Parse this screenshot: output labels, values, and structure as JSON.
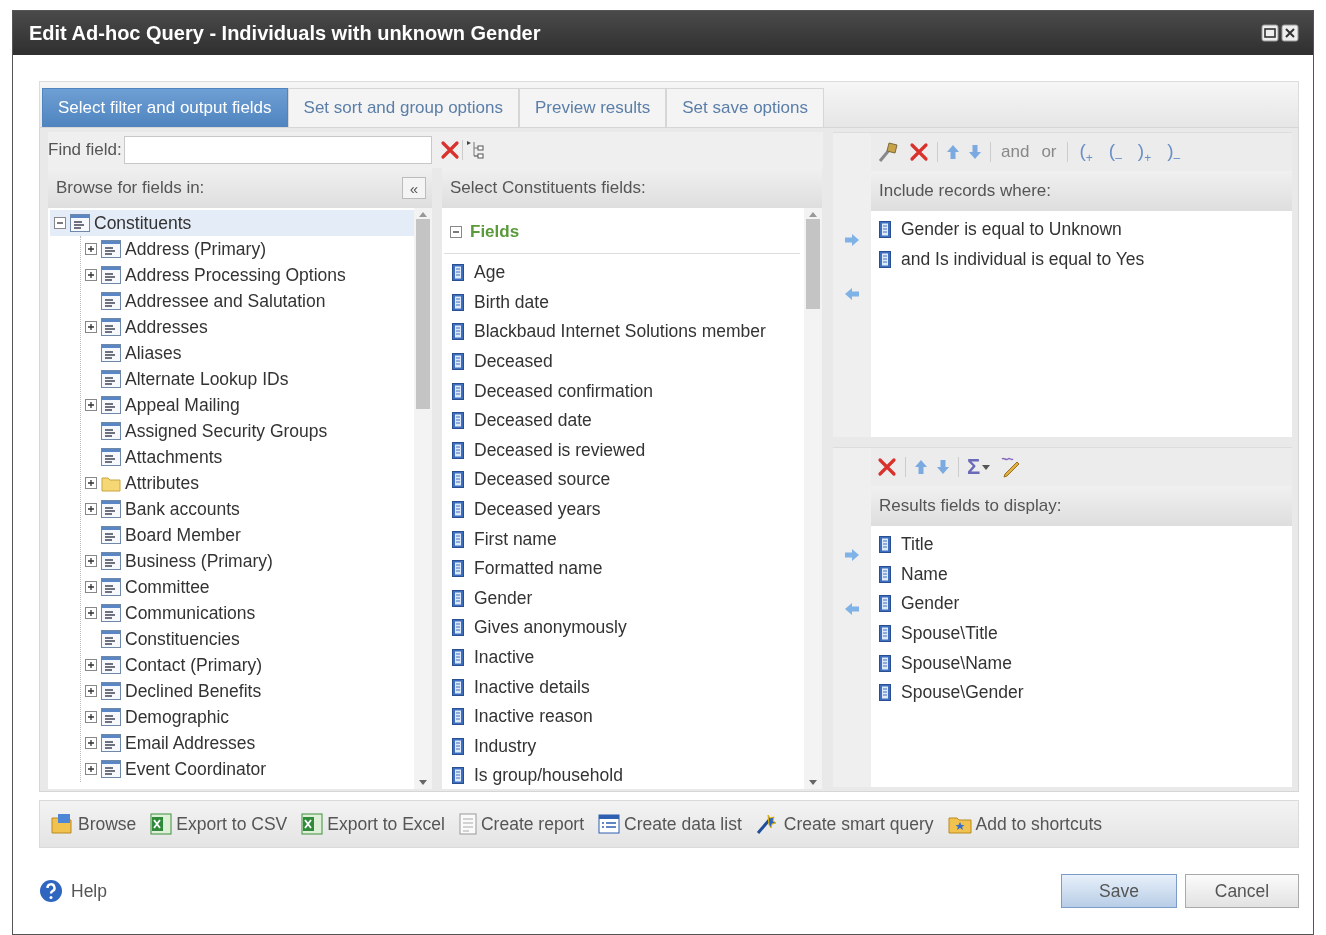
{
  "window": {
    "title": "Edit Ad-hoc Query - Individuals with unknown Gender"
  },
  "tabs": [
    {
      "label": "Select filter and output fields",
      "selected": true
    },
    {
      "label": "Set sort and group options",
      "selected": false
    },
    {
      "label": "Preview results",
      "selected": false
    },
    {
      "label": "Set save options",
      "selected": false
    }
  ],
  "find_field": {
    "label": "Find field:"
  },
  "browse_pane": {
    "header": "Browse for fields in:",
    "collapse": "«"
  },
  "tree": [
    {
      "label": "Constituents",
      "kind": "branch",
      "expanded": true,
      "selected": true,
      "children": [
        {
          "label": "Address (Primary)",
          "kind": "branch",
          "expanded": false,
          "selected": false
        },
        {
          "label": "Address Processing Options",
          "kind": "branch",
          "expanded": false,
          "selected": false
        },
        {
          "label": "Addressee and Salutation",
          "kind": "leaf",
          "selected": false
        },
        {
          "label": "Addresses",
          "kind": "branch",
          "expanded": false,
          "selected": false
        },
        {
          "label": "Aliases",
          "kind": "leaf",
          "selected": false
        },
        {
          "label": "Alternate Lookup IDs",
          "kind": "leaf",
          "selected": false
        },
        {
          "label": "Appeal Mailing",
          "kind": "branch",
          "expanded": false,
          "selected": false
        },
        {
          "label": "Assigned Security Groups",
          "kind": "leaf",
          "selected": false
        },
        {
          "label": "Attachments",
          "kind": "leaf",
          "selected": false
        },
        {
          "label": "Attributes",
          "kind": "folder",
          "expanded": false,
          "selected": false
        },
        {
          "label": "Bank accounts",
          "kind": "branch",
          "expanded": false,
          "selected": false
        },
        {
          "label": "Board Member",
          "kind": "leaf",
          "selected": false
        },
        {
          "label": "Business (Primary)",
          "kind": "branch",
          "expanded": false,
          "selected": false
        },
        {
          "label": "Committee",
          "kind": "branch",
          "expanded": false,
          "selected": false
        },
        {
          "label": "Communications",
          "kind": "branch",
          "expanded": false,
          "selected": false
        },
        {
          "label": "Constituencies",
          "kind": "leaf",
          "selected": false
        },
        {
          "label": "Contact (Primary)",
          "kind": "branch",
          "expanded": false,
          "selected": false
        },
        {
          "label": "Declined Benefits",
          "kind": "branch",
          "expanded": false,
          "selected": false
        },
        {
          "label": "Demographic",
          "kind": "branch",
          "expanded": false,
          "selected": false
        },
        {
          "label": "Email Addresses",
          "kind": "branch",
          "expanded": false,
          "selected": false
        },
        {
          "label": "Event Coordinator",
          "kind": "branch",
          "expanded": false,
          "selected": false
        }
      ]
    }
  ],
  "fields_pane": {
    "header": "Select Constituents fields:",
    "group": {
      "label": "Fields",
      "expanded": true
    },
    "items": [
      "Age",
      "Birth date",
      "Blackbaud Internet Solutions member",
      "Deceased",
      "Deceased confirmation",
      "Deceased date",
      "Deceased is reviewed",
      "Deceased source",
      "Deceased years",
      "First name",
      "Formatted name",
      "Gender",
      "Gives anonymously",
      "Inactive",
      "Inactive details",
      "Inactive reason",
      "Industry",
      "Is group/household"
    ]
  },
  "filter_panel": {
    "logic": [
      "and",
      "or"
    ],
    "parens": [
      "($_{+}$",
      "($_{–}$",
      ")$_{+}$",
      ")$_{–}$"
    ],
    "header": "Include records where:",
    "rows": [
      "Gender is equal to Unknown",
      "and Is individual is equal to Yes"
    ]
  },
  "results_panel": {
    "sum": "Σ",
    "header": "Results fields to display:",
    "rows": [
      "Title",
      "Name",
      "Gender",
      "Spouse\\Title",
      "Spouse\\Name",
      "Spouse\\Gender"
    ]
  },
  "actions": [
    {
      "label": "Browse",
      "kind": "browse"
    },
    {
      "label": "Export to CSV",
      "kind": "excel"
    },
    {
      "label": "Export to Excel",
      "kind": "excel"
    },
    {
      "label": "Create report",
      "kind": "report"
    },
    {
      "label": "Create data list",
      "kind": "datalist"
    },
    {
      "label": "Create smart query",
      "kind": "smart"
    },
    {
      "label": "Add to shortcuts",
      "kind": "shortcut"
    }
  ],
  "footer": {
    "help": "Help",
    "buttons": [
      {
        "label": "Save",
        "default": true
      },
      {
        "label": "Cancel",
        "default": false
      }
    ]
  }
}
